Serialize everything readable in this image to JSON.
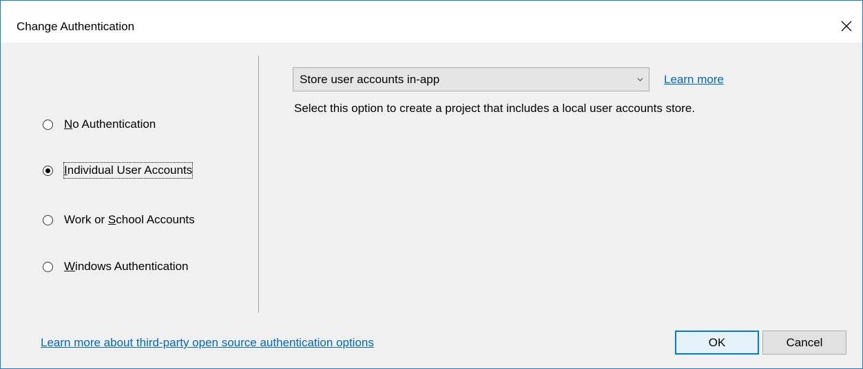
{
  "dialog": {
    "title": "Change Authentication",
    "close_icon": "close-icon"
  },
  "auth_options": [
    {
      "prefix": "",
      "accel": "N",
      "suffix": "o Authentication",
      "selected": false
    },
    {
      "prefix": "",
      "accel": "I",
      "suffix": "ndividual User Accounts",
      "selected": true
    },
    {
      "prefix": "Work or ",
      "accel": "S",
      "suffix": "chool Accounts",
      "selected": false
    },
    {
      "prefix": "",
      "accel": "W",
      "suffix": "indows Authentication",
      "selected": false
    }
  ],
  "store_dropdown": {
    "value": "Store user accounts in-app",
    "arrow_icon": "chevron-down-icon"
  },
  "learn_more_label": "Learn more",
  "description": "Select this option to create a project that includes a local user accounts store.",
  "third_party_link": "Learn more about third-party open source authentication options",
  "buttons": {
    "ok": "OK",
    "cancel": "Cancel"
  },
  "colors": {
    "accent": "#0078d7",
    "link": "#0066cc",
    "window_border": "#1979ca"
  }
}
